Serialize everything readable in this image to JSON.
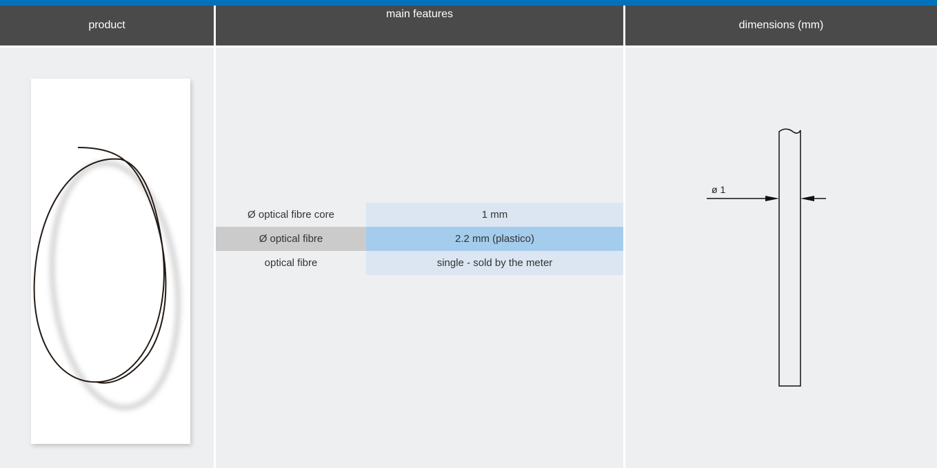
{
  "header": {
    "product": "product",
    "main_features": "main features",
    "dimensions": "dimensions (mm)"
  },
  "product": {
    "image_icon": "coiled-optical-fibre-icon"
  },
  "features": [
    {
      "label": "Ø optical fibre core",
      "value": "1 mm"
    },
    {
      "label": "Ø optical fibre",
      "value": "2.2 mm (plastico)"
    },
    {
      "label": "optical fibre",
      "value": "single - sold by the meter"
    }
  ],
  "dimensions": {
    "diameter_label": "ø 1"
  },
  "colors": {
    "accent": "#0072bc",
    "header_bg": "#4a4a4a",
    "panel_bg": "#eeeff1",
    "value_light": "#dbe6f2",
    "value_highlight": "#a4ccec",
    "label_highlight": "#cbcbcb"
  }
}
